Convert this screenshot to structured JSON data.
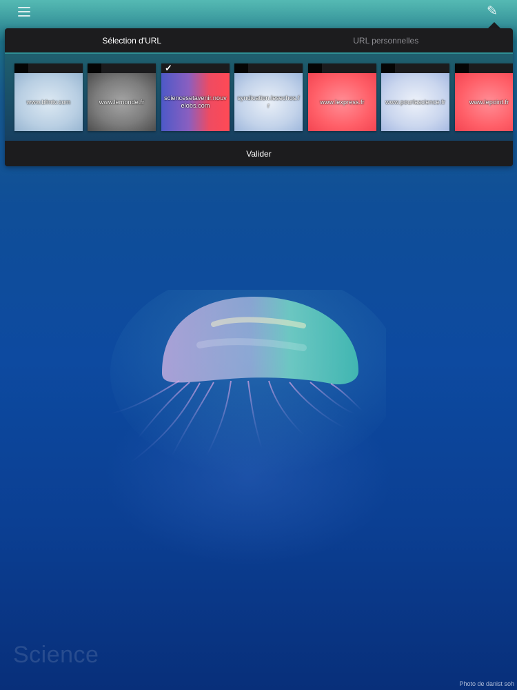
{
  "header": {
    "menu_icon": "hamburger-menu-icon",
    "edit_icon": "pencil-edit-icon",
    "edit_glyph": "✎"
  },
  "popover": {
    "tabs": [
      {
        "label": "Sélection d'URL",
        "active": true
      },
      {
        "label": "URL personnelles",
        "active": false
      }
    ],
    "accent_color": "#2e8f95",
    "thumbnails": [
      {
        "label": "www.bfmtv.com",
        "selected": false,
        "style": "lightblue"
      },
      {
        "label": "www.lemonde.fr",
        "selected": false,
        "style": "gray"
      },
      {
        "label": "sciencesetavenir.nouvelobs.com",
        "selected": true,
        "style": "sciences"
      },
      {
        "label": "syndication.lesechos.fr",
        "selected": false,
        "style": "paleblue"
      },
      {
        "label": "www.lexpress.fr",
        "selected": false,
        "style": "red"
      },
      {
        "label": "www.pourlascience.fr",
        "selected": false,
        "style": "pourla"
      },
      {
        "label": "www.lepoint.fr",
        "selected": false,
        "style": "red"
      }
    ],
    "check_glyph": "✓",
    "validate_label": "Valider"
  },
  "background": {
    "category_title": "Science",
    "photo_credit": "Photo de danist soh"
  }
}
